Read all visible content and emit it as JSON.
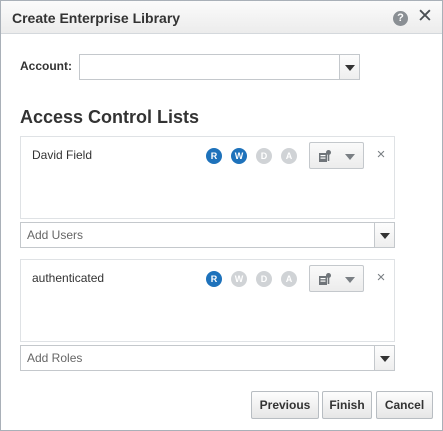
{
  "dialog": {
    "title": "Create Enterprise Library",
    "help_glyph": "?",
    "close_glyph": "✕"
  },
  "account": {
    "label": "Account:",
    "value": ""
  },
  "acl": {
    "title": "Access Control Lists",
    "users": [
      {
        "name": "David Field",
        "permissions": [
          {
            "letter": "R",
            "on": true
          },
          {
            "letter": "W",
            "on": true
          },
          {
            "letter": "D",
            "on": false
          },
          {
            "letter": "A",
            "on": false
          }
        ]
      }
    ],
    "add_users_placeholder": "Add Users",
    "roles": [
      {
        "name": "authenticated",
        "permissions": [
          {
            "letter": "R",
            "on": true
          },
          {
            "letter": "W",
            "on": false
          },
          {
            "letter": "D",
            "on": false
          },
          {
            "letter": "A",
            "on": false
          }
        ]
      }
    ],
    "add_roles_placeholder": "Add Roles",
    "remove_glyph": "×"
  },
  "buttons": {
    "previous": "Previous",
    "finish": "Finish",
    "cancel": "Cancel"
  },
  "colors": {
    "permission_on": "#1e72bb",
    "permission_off": "#d0d3d6"
  },
  "icons": {
    "role_menu": "user-role-icon"
  }
}
